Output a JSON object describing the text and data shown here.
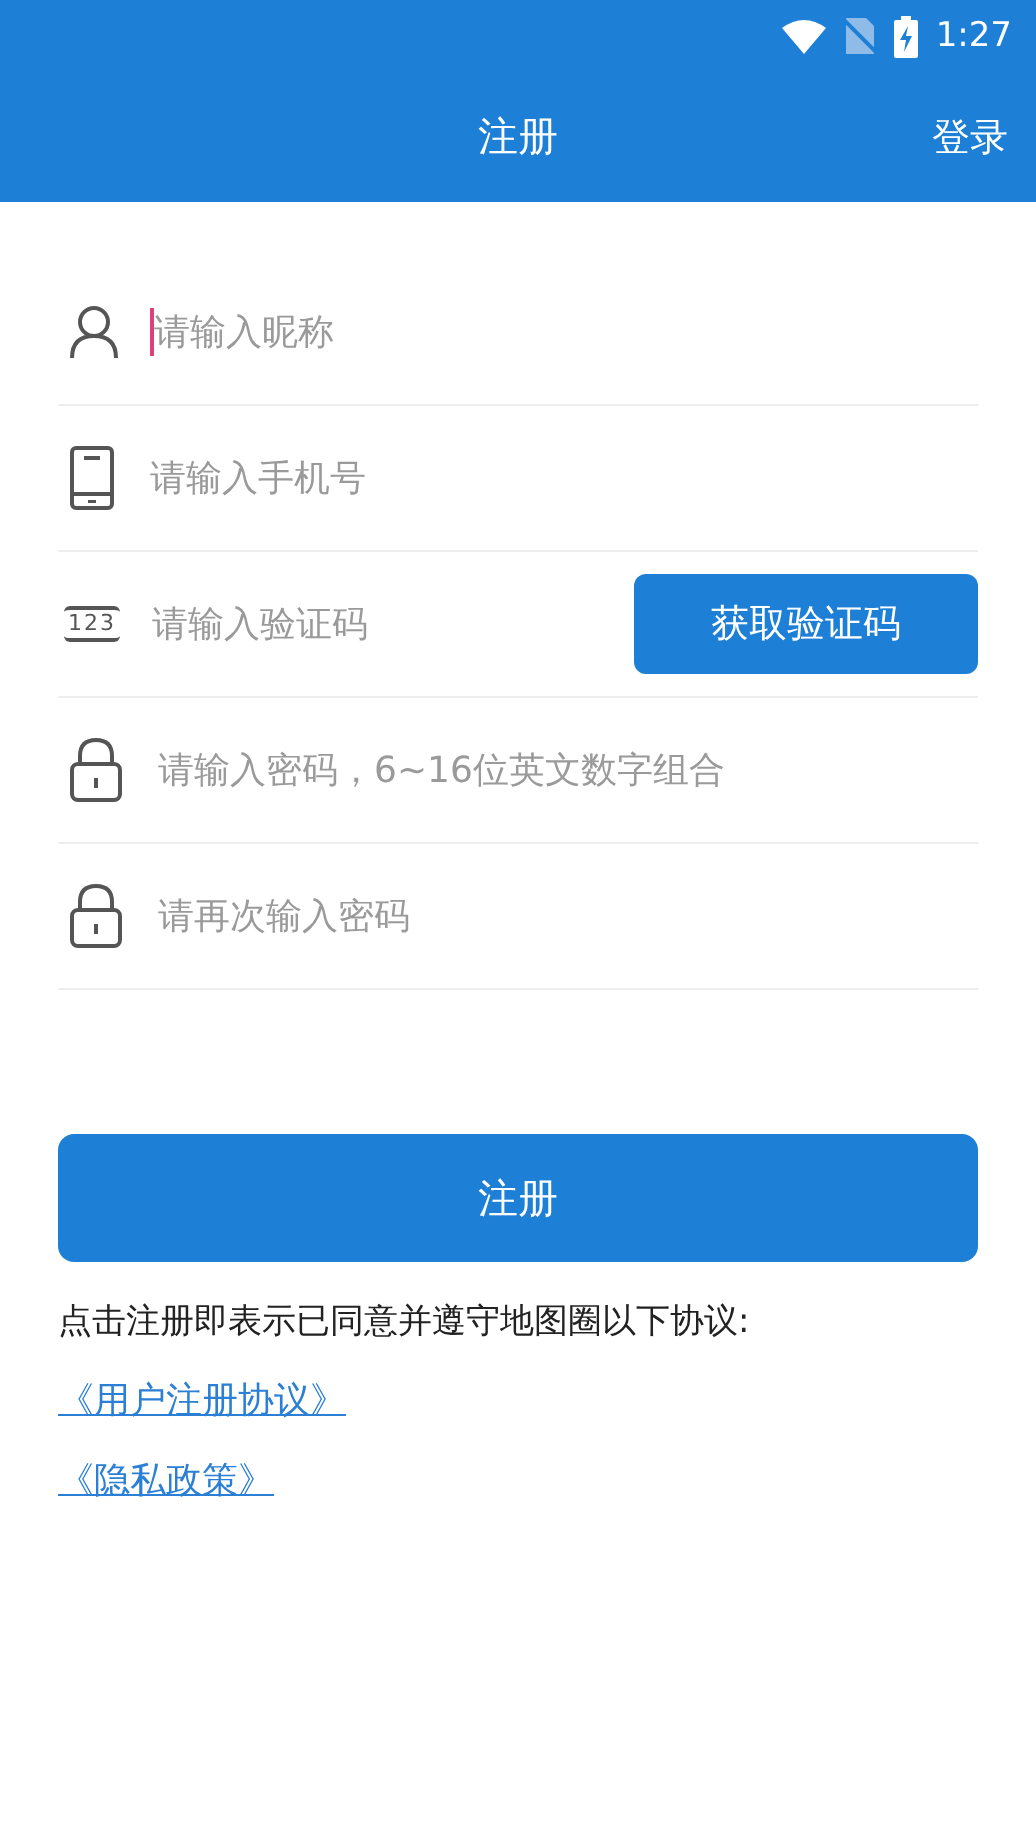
{
  "status_bar": {
    "time": "1:27"
  },
  "header": {
    "title": "注册",
    "action": "登录"
  },
  "fields": [
    {
      "kind": "user",
      "placeholder": "请输入昵称",
      "focused": true
    },
    {
      "kind": "phone",
      "placeholder": "请输入手机号",
      "focused": false
    },
    {
      "kind": "code",
      "placeholder": "请输入验证码",
      "focused": false,
      "icon_text": "123",
      "button": "获取验证码"
    },
    {
      "kind": "lock",
      "placeholder": "请输入密码，6~16位英文数字组合",
      "focused": false
    },
    {
      "kind": "lock",
      "placeholder": "请再次输入密码",
      "focused": false
    }
  ],
  "submit": "注册",
  "agreement": "点击注册即表示已同意并遵守地图圈以下协议:",
  "links": [
    "《用户注册协议》",
    "《隐私政策》"
  ]
}
